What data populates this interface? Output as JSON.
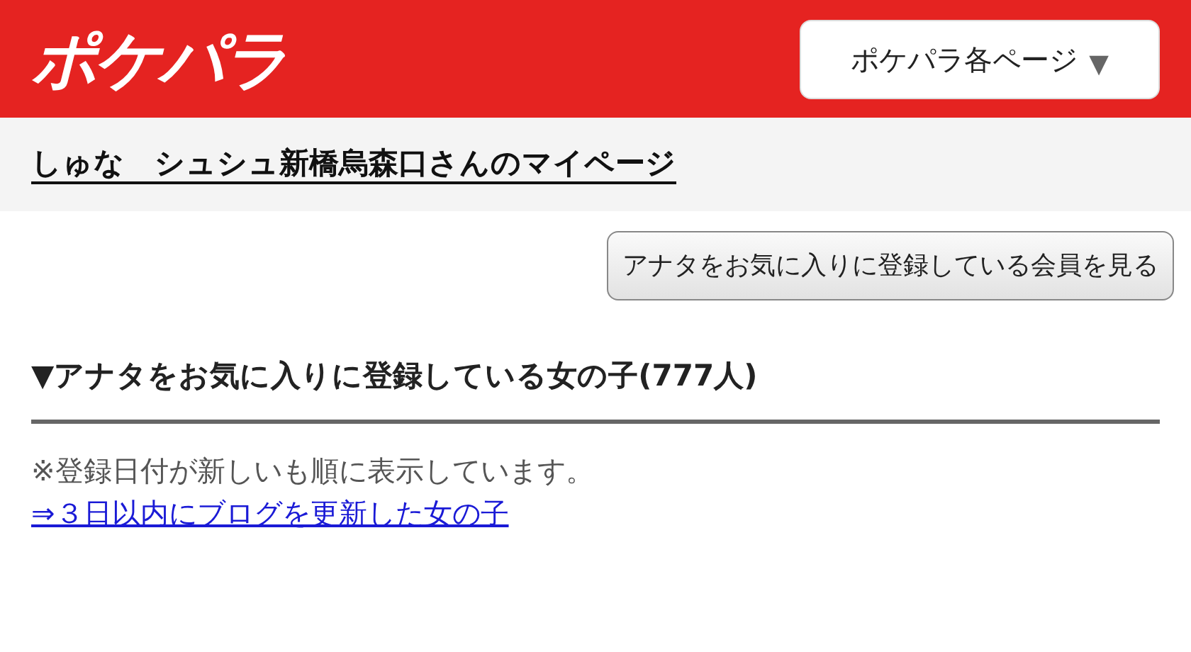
{
  "header": {
    "logo": "ポケパラ",
    "menu_button": {
      "label": "ポケパラ各ページ",
      "caret": "▼"
    }
  },
  "page_title": "しゅな　シュシュ新橋烏森口さんのマイページ",
  "members_button": "アナタをお気に入りに登録している会員を見る",
  "section": {
    "heading": "▼アナタをお気に入りに登録している女の子(777人)",
    "note": "※登録日付が新しいも順に表示しています。",
    "link": "⇒３日以内にブログを更新した女の子"
  }
}
